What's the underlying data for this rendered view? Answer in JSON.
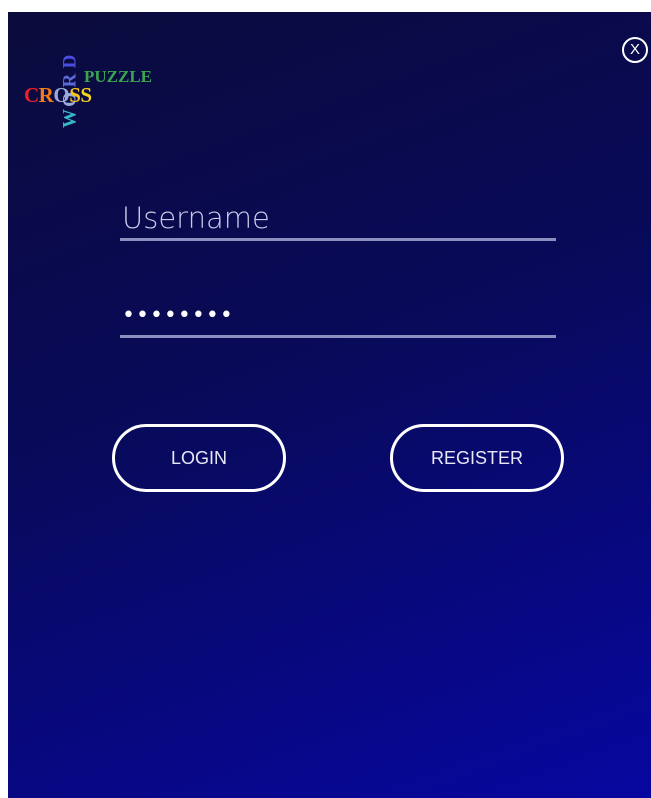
{
  "window": {
    "close_label": "X"
  },
  "logo": {
    "cross": [
      {
        "ch": "C",
        "color": "#e8202a"
      },
      {
        "ch": "R",
        "color": "#f07b1c"
      },
      {
        "ch": "O",
        "color": "#9aa9d8"
      },
      {
        "ch": "S",
        "color": "#f3c51c"
      },
      {
        "ch": "S",
        "color": "#f6d420"
      }
    ],
    "word": [
      {
        "ch": "W",
        "color": "#36b8c8"
      },
      {
        "ch": "O",
        "color": "#9aa9d8"
      },
      {
        "ch": "R",
        "color": "#5c6ad8"
      },
      {
        "ch": "D",
        "color": "#4a4ee0"
      }
    ],
    "puzzle": "PUZZLE"
  },
  "form": {
    "username_placeholder": "Username",
    "password_value": "********",
    "login_label": "LOGIN",
    "register_label": "REGISTER"
  },
  "colors": {
    "background_top": "#0b0b3c",
    "background_bottom": "#0707a0",
    "field_underline": "#8b8fbf"
  }
}
